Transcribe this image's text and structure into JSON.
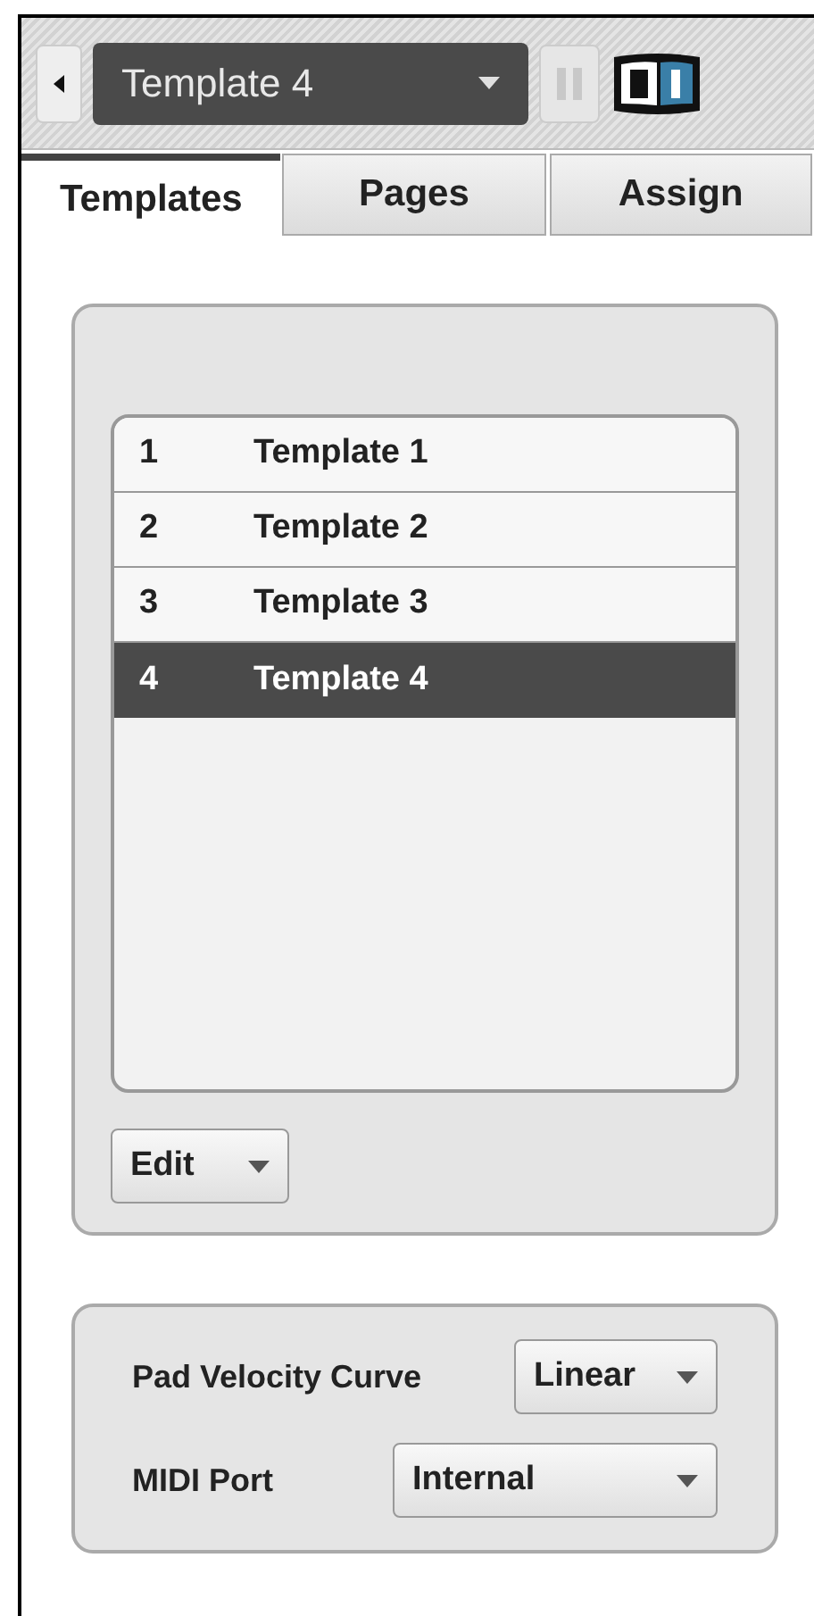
{
  "header": {
    "template_selector": {
      "value": "Template 4"
    }
  },
  "tabs": [
    {
      "label": "Templates",
      "selected": true
    },
    {
      "label": "Pages",
      "selected": false
    },
    {
      "label": "Assign",
      "selected": false
    }
  ],
  "templates": [
    {
      "number": "1",
      "name": "Template 1",
      "selected": false
    },
    {
      "number": "2",
      "name": "Template 2",
      "selected": false
    },
    {
      "number": "3",
      "name": "Template 3",
      "selected": false
    },
    {
      "number": "4",
      "name": "Template 4",
      "selected": true
    }
  ],
  "edit_menu": {
    "label": "Edit"
  },
  "settings": [
    {
      "label": "Pad Velocity Curve",
      "value": "Linear",
      "wide": false
    },
    {
      "label": "MIDI Port",
      "value": "Internal",
      "wide": true
    }
  ]
}
